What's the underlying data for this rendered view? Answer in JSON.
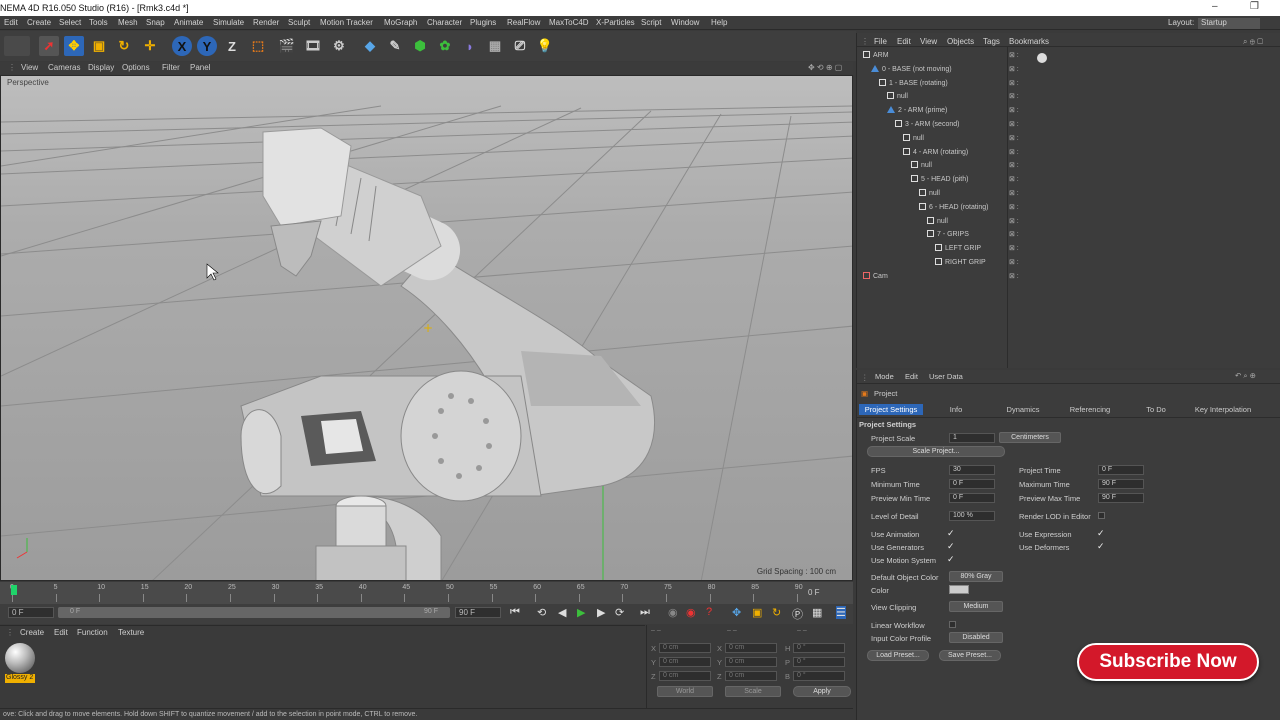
{
  "window": {
    "title": "NEMA 4D R16.050 Studio (R16) - [Rmk3.c4d *]"
  },
  "menu": [
    "Edit",
    "Create",
    "Select",
    "Tools",
    "Mesh",
    "Snap",
    "Animate",
    "Simulate",
    "Render",
    "Sculpt",
    "Motion Tracker",
    "MoGraph",
    "Character",
    "Plugins",
    "RealFlow",
    "MaxToC4D",
    "X-Particles",
    "Script",
    "Window",
    "Help"
  ],
  "layout": {
    "label": "Layout:",
    "value": "Startup"
  },
  "toolbar": {
    "x": "X",
    "y": "Y",
    "z": "Z"
  },
  "viewport": {
    "menu": [
      "View",
      "Cameras",
      "Display",
      "Options",
      "Filter",
      "Panel"
    ],
    "label": "Perspective",
    "grid_spacing": "Grid Spacing : 100 cm"
  },
  "timeline": {
    "ticks": [
      "0",
      "5",
      "10",
      "15",
      "20",
      "25",
      "30",
      "35",
      "40",
      "45",
      "50",
      "55",
      "60",
      "65",
      "70",
      "75",
      "80",
      "85",
      "90"
    ],
    "end_label": "0 F",
    "start_field": "0 F",
    "slider_start": "0 F",
    "slider_end": "90 F",
    "end_field": "90 F"
  },
  "material": {
    "menu": [
      "Create",
      "Edit",
      "Function",
      "Texture"
    ],
    "name": "Glossy 2"
  },
  "coords": {
    "rows": [
      [
        "X",
        "0 cm",
        "X",
        "0 cm",
        "H",
        "0 °"
      ],
      [
        "Y",
        "0 cm",
        "Y",
        "0 cm",
        "P",
        "0 °"
      ],
      [
        "Z",
        "0 cm",
        "Z",
        "0 cm",
        "B",
        "0 °"
      ]
    ],
    "world": "World",
    "scale": "Scale",
    "apply": "Apply"
  },
  "status": "ove: Click and drag to move elements. Hold down SHIFT to quantize movement / add to the selection in point mode, CTRL to remove.",
  "objects": {
    "menu": [
      "File",
      "Edit",
      "View",
      "Objects",
      "Tags",
      "Bookmarks"
    ],
    "items": [
      {
        "label": "ARM",
        "indent": 0,
        "type": "null"
      },
      {
        "label": "0 - BASE (not moving)",
        "indent": 1,
        "type": "joint"
      },
      {
        "label": "1 - BASE (rotating)",
        "indent": 2,
        "type": "null"
      },
      {
        "label": "null",
        "indent": 3,
        "type": "null"
      },
      {
        "label": "2 - ARM (prime)",
        "indent": 3,
        "type": "joint"
      },
      {
        "label": "3 - ARM (second)",
        "indent": 4,
        "type": "null"
      },
      {
        "label": "null",
        "indent": 5,
        "type": "null"
      },
      {
        "label": "4 - ARM (rotating)",
        "indent": 5,
        "type": "null"
      },
      {
        "label": "null",
        "indent": 6,
        "type": "null"
      },
      {
        "label": "5 - HEAD (pith)",
        "indent": 6,
        "type": "null"
      },
      {
        "label": "null",
        "indent": 7,
        "type": "null"
      },
      {
        "label": "6 - HEAD (rotating)",
        "indent": 7,
        "type": "null"
      },
      {
        "label": "null",
        "indent": 8,
        "type": "null"
      },
      {
        "label": "7 - GRIPS",
        "indent": 8,
        "type": "null"
      },
      {
        "label": "LEFT GRIP",
        "indent": 9,
        "type": "null"
      },
      {
        "label": "RIGHT GRIP",
        "indent": 9,
        "type": "null"
      },
      {
        "label": "Cam",
        "indent": 0,
        "type": "cam"
      }
    ]
  },
  "attributes": {
    "menu": [
      "Mode",
      "Edit",
      "User Data"
    ],
    "header": "Project",
    "tabs": [
      "Project Settings",
      "Info",
      "Dynamics",
      "Referencing",
      "To Do",
      "Key Interpolation"
    ],
    "section": "Project Settings",
    "project_scale": {
      "label": "Project Scale",
      "value": "1",
      "unit": "Centimeters"
    },
    "scale_project": "Scale Project...",
    "fps": {
      "label": "FPS",
      "value": "30"
    },
    "project_time": {
      "label": "Project Time",
      "value": "0 F"
    },
    "min_time": {
      "label": "Minimum Time",
      "value": "0 F"
    },
    "max_time": {
      "label": "Maximum Time",
      "value": "90 F"
    },
    "prev_min": {
      "label": "Preview Min Time",
      "value": "0 F"
    },
    "prev_max": {
      "label": "Preview Max Time",
      "value": "90 F"
    },
    "lod": {
      "label": "Level of Detail",
      "value": "100 %"
    },
    "render_lod": "Render LOD in Editor",
    "use_animation": "Use Animation",
    "use_expression": "Use Expression",
    "use_generators": "Use Generators",
    "use_deformers": "Use Deformers",
    "use_motion": "Use Motion System",
    "default_color": {
      "label": "Default Object Color",
      "value": "80% Gray"
    },
    "color": "Color",
    "view_clipping": {
      "label": "View Clipping",
      "value": "Medium"
    },
    "linear_workflow": "Linear Workflow",
    "input_profile": {
      "label": "Input Color Profile",
      "value": "Disabled"
    },
    "load_preset": "Load Preset...",
    "save_preset": "Save Preset..."
  },
  "subscribe": "Subscribe Now",
  "colors": {
    "accent": "#4a8dd8",
    "tab_active": "#2d67b8",
    "subscribe": "#d3182a"
  }
}
